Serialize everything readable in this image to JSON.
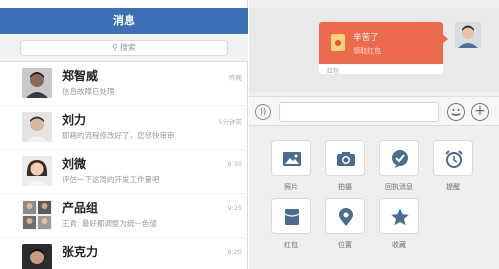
{
  "left": {
    "title": "消息",
    "search_placeholder": "搜索",
    "rows": [
      {
        "name": "郑智威",
        "msg": "信息故障已处理",
        "time": "昨晚"
      },
      {
        "name": "刘力",
        "msg": "即箱的流程修改好了，您尽快审审",
        "time": "5分钟前"
      },
      {
        "name": "刘微",
        "msg": "评估一下这周的开发工作量吧",
        "time": "9:30"
      },
      {
        "name": "产品组",
        "msg": "王青: 最好都调整为统一色値",
        "time": "9:25"
      },
      {
        "name": "张克力",
        "msg": "",
        "time": "9:20"
      }
    ]
  },
  "right": {
    "red_packet": {
      "title": "辛苦了",
      "subtitle": "领取红包",
      "label": "红包"
    },
    "tools": [
      {
        "label": "照片",
        "icon": "photo-icon"
      },
      {
        "label": "拍摄",
        "icon": "camera-icon"
      },
      {
        "label": "回执消息",
        "icon": "receipt-check-icon"
      },
      {
        "label": "提醒",
        "icon": "alarm-clock-icon"
      },
      {
        "label": "红包",
        "icon": "red-packet-icon"
      },
      {
        "label": "位置",
        "icon": "location-pin-icon"
      },
      {
        "label": "收藏",
        "icon": "star-icon"
      }
    ]
  },
  "colors": {
    "header_blue": "#3b6fb6",
    "red_packet": "#ec6b4d",
    "icon_blue": "#4a6d8f"
  }
}
